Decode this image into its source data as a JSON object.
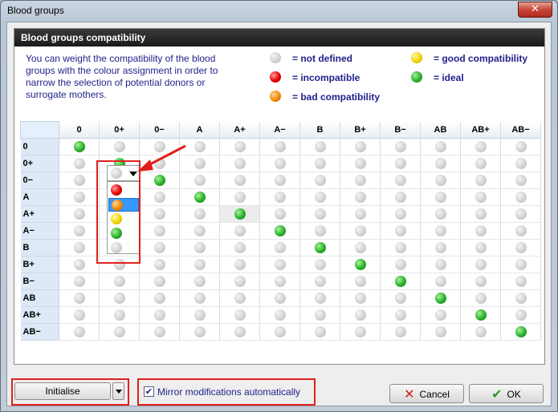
{
  "window": {
    "title": "Blood groups",
    "close_label": "✕"
  },
  "panel": {
    "header": "Blood groups compatibility",
    "description": "You can weight the compatibility of the blood groups with the colour assignment in order to narrow the selection of potential donors or surrogate mothers."
  },
  "legend": [
    {
      "color": "grey",
      "label": "= not defined"
    },
    {
      "color": "red",
      "label": "= incompatible"
    },
    {
      "color": "orange",
      "label": "= bad compatibility"
    },
    {
      "color": "yellow",
      "label": "= good compatibility"
    },
    {
      "color": "green",
      "label": "= ideal"
    }
  ],
  "grid": {
    "columns": [
      "0",
      "0+",
      "0−",
      "A",
      "A+",
      "A−",
      "B",
      "B+",
      "B−",
      "AB",
      "AB+",
      "AB−"
    ],
    "rows": [
      "0",
      "0+",
      "0−",
      "A",
      "A+",
      "A−",
      "B",
      "B+",
      "B−",
      "AB",
      "AB+",
      "AB−"
    ],
    "ideal_color": "green",
    "default_color": "grey"
  },
  "dropdown": {
    "current": "grey",
    "options": [
      "red",
      "orange",
      "yellow",
      "green",
      "grey"
    ],
    "highlighted": "orange"
  },
  "footer": {
    "initialise_label": "Initialise",
    "mirror_label": "Mirror modifications automatically",
    "mirror_checked": true,
    "cancel_label": "Cancel",
    "ok_label": "OK"
  },
  "colors": {
    "accent_red": "#e0211b",
    "highlight_blue": "#3399ff",
    "text_blue": "#1f1f8a"
  }
}
